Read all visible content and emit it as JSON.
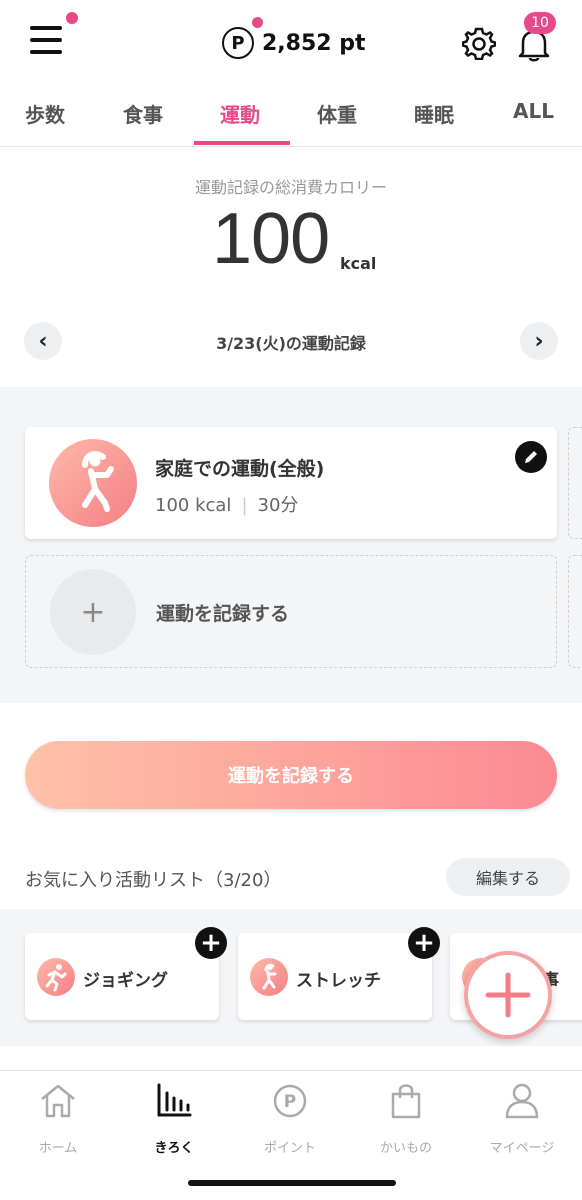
{
  "header": {
    "points_symbol": "P",
    "points_value": "2,852 pt",
    "notification_count": "10",
    "accent_color": "#e8498a"
  },
  "tabs": [
    {
      "label": "歩数"
    },
    {
      "label": "食事"
    },
    {
      "label": "運動",
      "active": true
    },
    {
      "label": "体重"
    },
    {
      "label": "睡眠"
    },
    {
      "label": "ALL"
    }
  ],
  "summary": {
    "label": "運動記録の総消費カロリー",
    "value": "100",
    "unit": "kcal"
  },
  "date_nav": {
    "prev_icon": "‹",
    "next_icon": "›",
    "label": "3/23(火)の運動記録"
  },
  "record": {
    "title": "家庭での運動(全般)",
    "calories": "100 kcal",
    "separator": "|",
    "duration": "30分"
  },
  "add_record": {
    "plus": "+",
    "label": "運動を記録する"
  },
  "main_button": {
    "label": "運動を記録する"
  },
  "favorites": {
    "title": "お気に入り活動リスト（3/20）",
    "edit_label": "編集する",
    "items": [
      {
        "label": "ジョギング"
      },
      {
        "label": "ストレッチ"
      },
      {
        "label": "・食事"
      }
    ],
    "add_symbol": "+"
  },
  "bottom_nav": [
    {
      "label": "ホーム",
      "icon": "home-icon"
    },
    {
      "label": "きろく",
      "icon": "chart-icon",
      "active": true
    },
    {
      "label": "ポイント",
      "icon": "point-icon"
    },
    {
      "label": "かいもの",
      "icon": "shopping-bag-icon"
    },
    {
      "label": "マイページ",
      "icon": "user-icon"
    }
  ]
}
